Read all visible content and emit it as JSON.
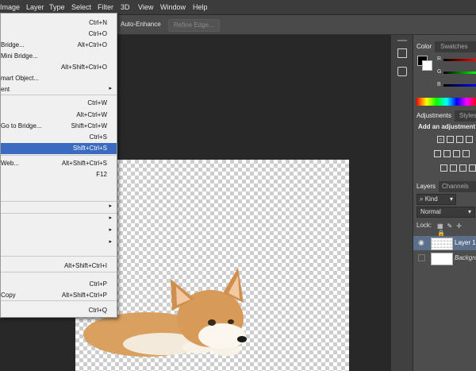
{
  "menubar": {
    "items": [
      "Image",
      "Layer",
      "Type",
      "Select",
      "Filter",
      "3D",
      "View",
      "Window",
      "Help"
    ]
  },
  "options": {
    "auto_enhance": "Auto-Enhance",
    "refine_edge": "Refine Edge..."
  },
  "file_menu": {
    "items": [
      {
        "label": "",
        "shortcut": "Ctrl+N",
        "submenu": false
      },
      {
        "label": "",
        "shortcut": "Ctrl+O",
        "submenu": false
      },
      {
        "label": "Bridge...",
        "shortcut": "Alt+Ctrl+O",
        "submenu": false
      },
      {
        "label": "Mini Bridge...",
        "shortcut": "",
        "submenu": false
      },
      {
        "label": "",
        "shortcut": "Alt+Shift+Ctrl+O",
        "submenu": false
      },
      {
        "label": "mart Object...",
        "shortcut": "",
        "submenu": false
      },
      {
        "label": "ent",
        "shortcut": "",
        "submenu": true
      },
      {
        "label": "",
        "shortcut": "Ctrl+W",
        "submenu": false
      },
      {
        "label": "",
        "shortcut": "Alt+Ctrl+W",
        "submenu": false
      },
      {
        "label": "Go to Bridge...",
        "shortcut": "Shift+Ctrl+W",
        "submenu": false
      },
      {
        "label": "",
        "shortcut": "Ctrl+S",
        "submenu": false
      },
      {
        "label": "",
        "shortcut": "Shift+Ctrl+S",
        "submenu": false,
        "highlighted": true
      },
      {
        "label": "Web...",
        "shortcut": "Alt+Shift+Ctrl+S",
        "submenu": false
      },
      {
        "label": "",
        "shortcut": "F12",
        "submenu": false
      },
      {
        "label": "",
        "shortcut": "",
        "submenu": true
      },
      {
        "label": "",
        "shortcut": "",
        "submenu": true
      },
      {
        "label": "",
        "shortcut": "",
        "submenu": true
      },
      {
        "label": "",
        "shortcut": "",
        "submenu": true
      },
      {
        "label": "",
        "shortcut": "Alt+Shift+Ctrl+I",
        "submenu": false
      },
      {
        "label": "",
        "shortcut": "Ctrl+P",
        "submenu": false
      },
      {
        "label": "Copy",
        "shortcut": "Alt+Shift+Ctrl+P",
        "submenu": false
      },
      {
        "label": "",
        "shortcut": "Ctrl+Q",
        "submenu": false
      }
    ]
  },
  "color_panel": {
    "tabs": [
      "Color",
      "Swatches"
    ],
    "channels": [
      "R",
      "G",
      "B"
    ]
  },
  "adjustments_panel": {
    "tabs": [
      "Adjustments",
      "Styles"
    ],
    "title": "Add an adjustment"
  },
  "layers_panel": {
    "tabs": [
      "Layers",
      "Channels"
    ],
    "filter": "Kind",
    "blend_mode": "Normal",
    "lock_label": "Lock:",
    "layers": [
      {
        "name": "Layer 1",
        "visible": true,
        "selected": true
      },
      {
        "name": "Backgro",
        "visible": false,
        "selected": false
      }
    ]
  },
  "colors": {
    "highlight": "#3a6bc1",
    "menu_bg": "#f0f0f0",
    "panel_bg": "#4d4d4d"
  }
}
